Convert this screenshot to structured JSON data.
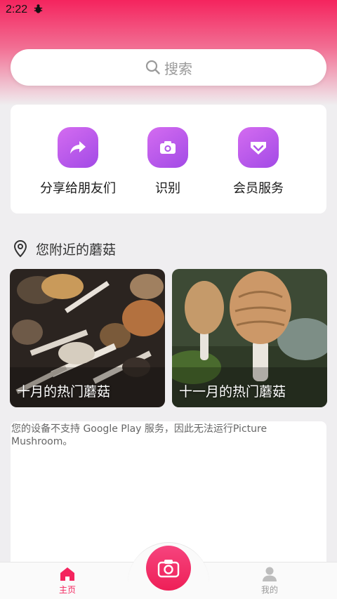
{
  "status_bar": {
    "time": "2:22",
    "notification_icon": "bug-icon"
  },
  "search": {
    "placeholder": "搜索"
  },
  "actions": [
    {
      "label": "分享给朋友们",
      "icon": "share-arrow-icon"
    },
    {
      "label": "识别",
      "icon": "camera-icon"
    },
    {
      "label": "会员服务",
      "icon": "diamond-icon"
    }
  ],
  "nearby": {
    "title": "您附近的蘑菇",
    "cards": [
      {
        "caption": "十月的热门蘑菇"
      },
      {
        "caption": "十一月的热门蘑菇"
      }
    ]
  },
  "web_notice": "您的设备不支持 Google Play 服务，因此无法运行Picture Mushroom。",
  "bottom_nav": {
    "home": "主页",
    "mine": "我的"
  },
  "colors": {
    "brand": "#f4245e",
    "accent_purple": "#b256ea",
    "nav_active": "#f4245e",
    "nav_inactive": "#9a9a9a"
  }
}
